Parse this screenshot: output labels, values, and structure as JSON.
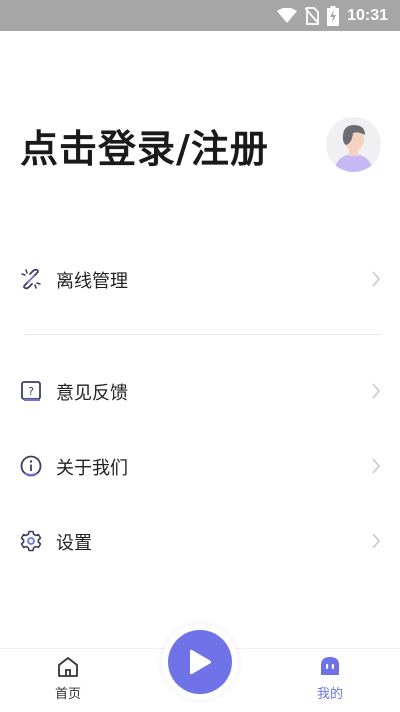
{
  "status_bar": {
    "time": "10:31",
    "icons": [
      "wifi-icon",
      "no-sim-icon",
      "battery-charging-icon"
    ]
  },
  "header": {
    "login_text": "点击登录/注册",
    "avatar_icon": "default-avatar-icon"
  },
  "menu": {
    "items": [
      {
        "label": "离线管理",
        "icon": "offline-link-icon"
      },
      {
        "label": "意见反馈",
        "icon": "feedback-icon"
      },
      {
        "label": "关于我们",
        "icon": "info-icon"
      },
      {
        "label": "设置",
        "icon": "gear-icon"
      }
    ]
  },
  "tab_bar": {
    "tabs": [
      {
        "label": "首页",
        "icon": "home-icon",
        "active": false
      },
      {
        "label": "我的",
        "icon": "profile-ghost-icon",
        "active": true
      }
    ],
    "center_icon": "play-icon"
  },
  "colors": {
    "accent": "#7072e8",
    "text": "#222222",
    "chevron": "#c8c8c8",
    "status_bar": "#a6a6a6"
  }
}
